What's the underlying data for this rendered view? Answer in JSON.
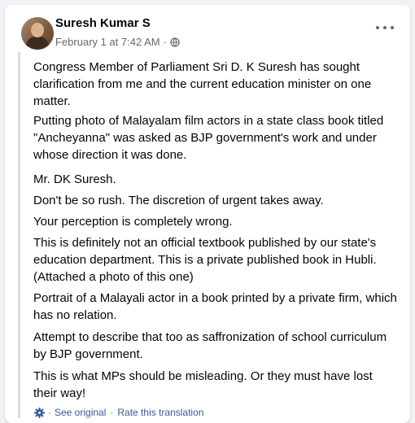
{
  "post": {
    "author": "Suresh Kumar S",
    "date": "February 1 at 7:42 AM",
    "separator": "·",
    "paragraphs": [
      "Congress Member of Parliament Sri D. K Suresh has sought clarification from me and the current education minister on one matter.",
      "Putting photo of Malayalam film actors in a state class book titled \"Ancheyanna\" was asked as BJP government's work and under whose direction it was done.",
      "Mr. DK Suresh.",
      "Don't be so rush. The discretion of urgent takes away.",
      "Your perception is completely wrong.",
      "This is definitely not an official textbook published by our state's education department. This is a private published book in Hubli. (Attached a photo of this one)",
      "Portrait of a Malayali actor in a book printed by a private firm, which has no relation.",
      "Attempt to describe that too as saffronization of school curriculum by BJP government.",
      "This is what MPs should be misleading. Or they must have lost their way!"
    ]
  },
  "translation": {
    "see_original": "See original",
    "separator": "·",
    "rate": "Rate this translation"
  },
  "icons": {
    "privacy": "globe-icon",
    "menu": "more-options-icon",
    "translate": "gear-icon"
  },
  "colors": {
    "background": "#f0f2f5",
    "text": "#050505",
    "meta": "#65676b",
    "link": "#385898",
    "quote_bar": "#d9dbde"
  }
}
